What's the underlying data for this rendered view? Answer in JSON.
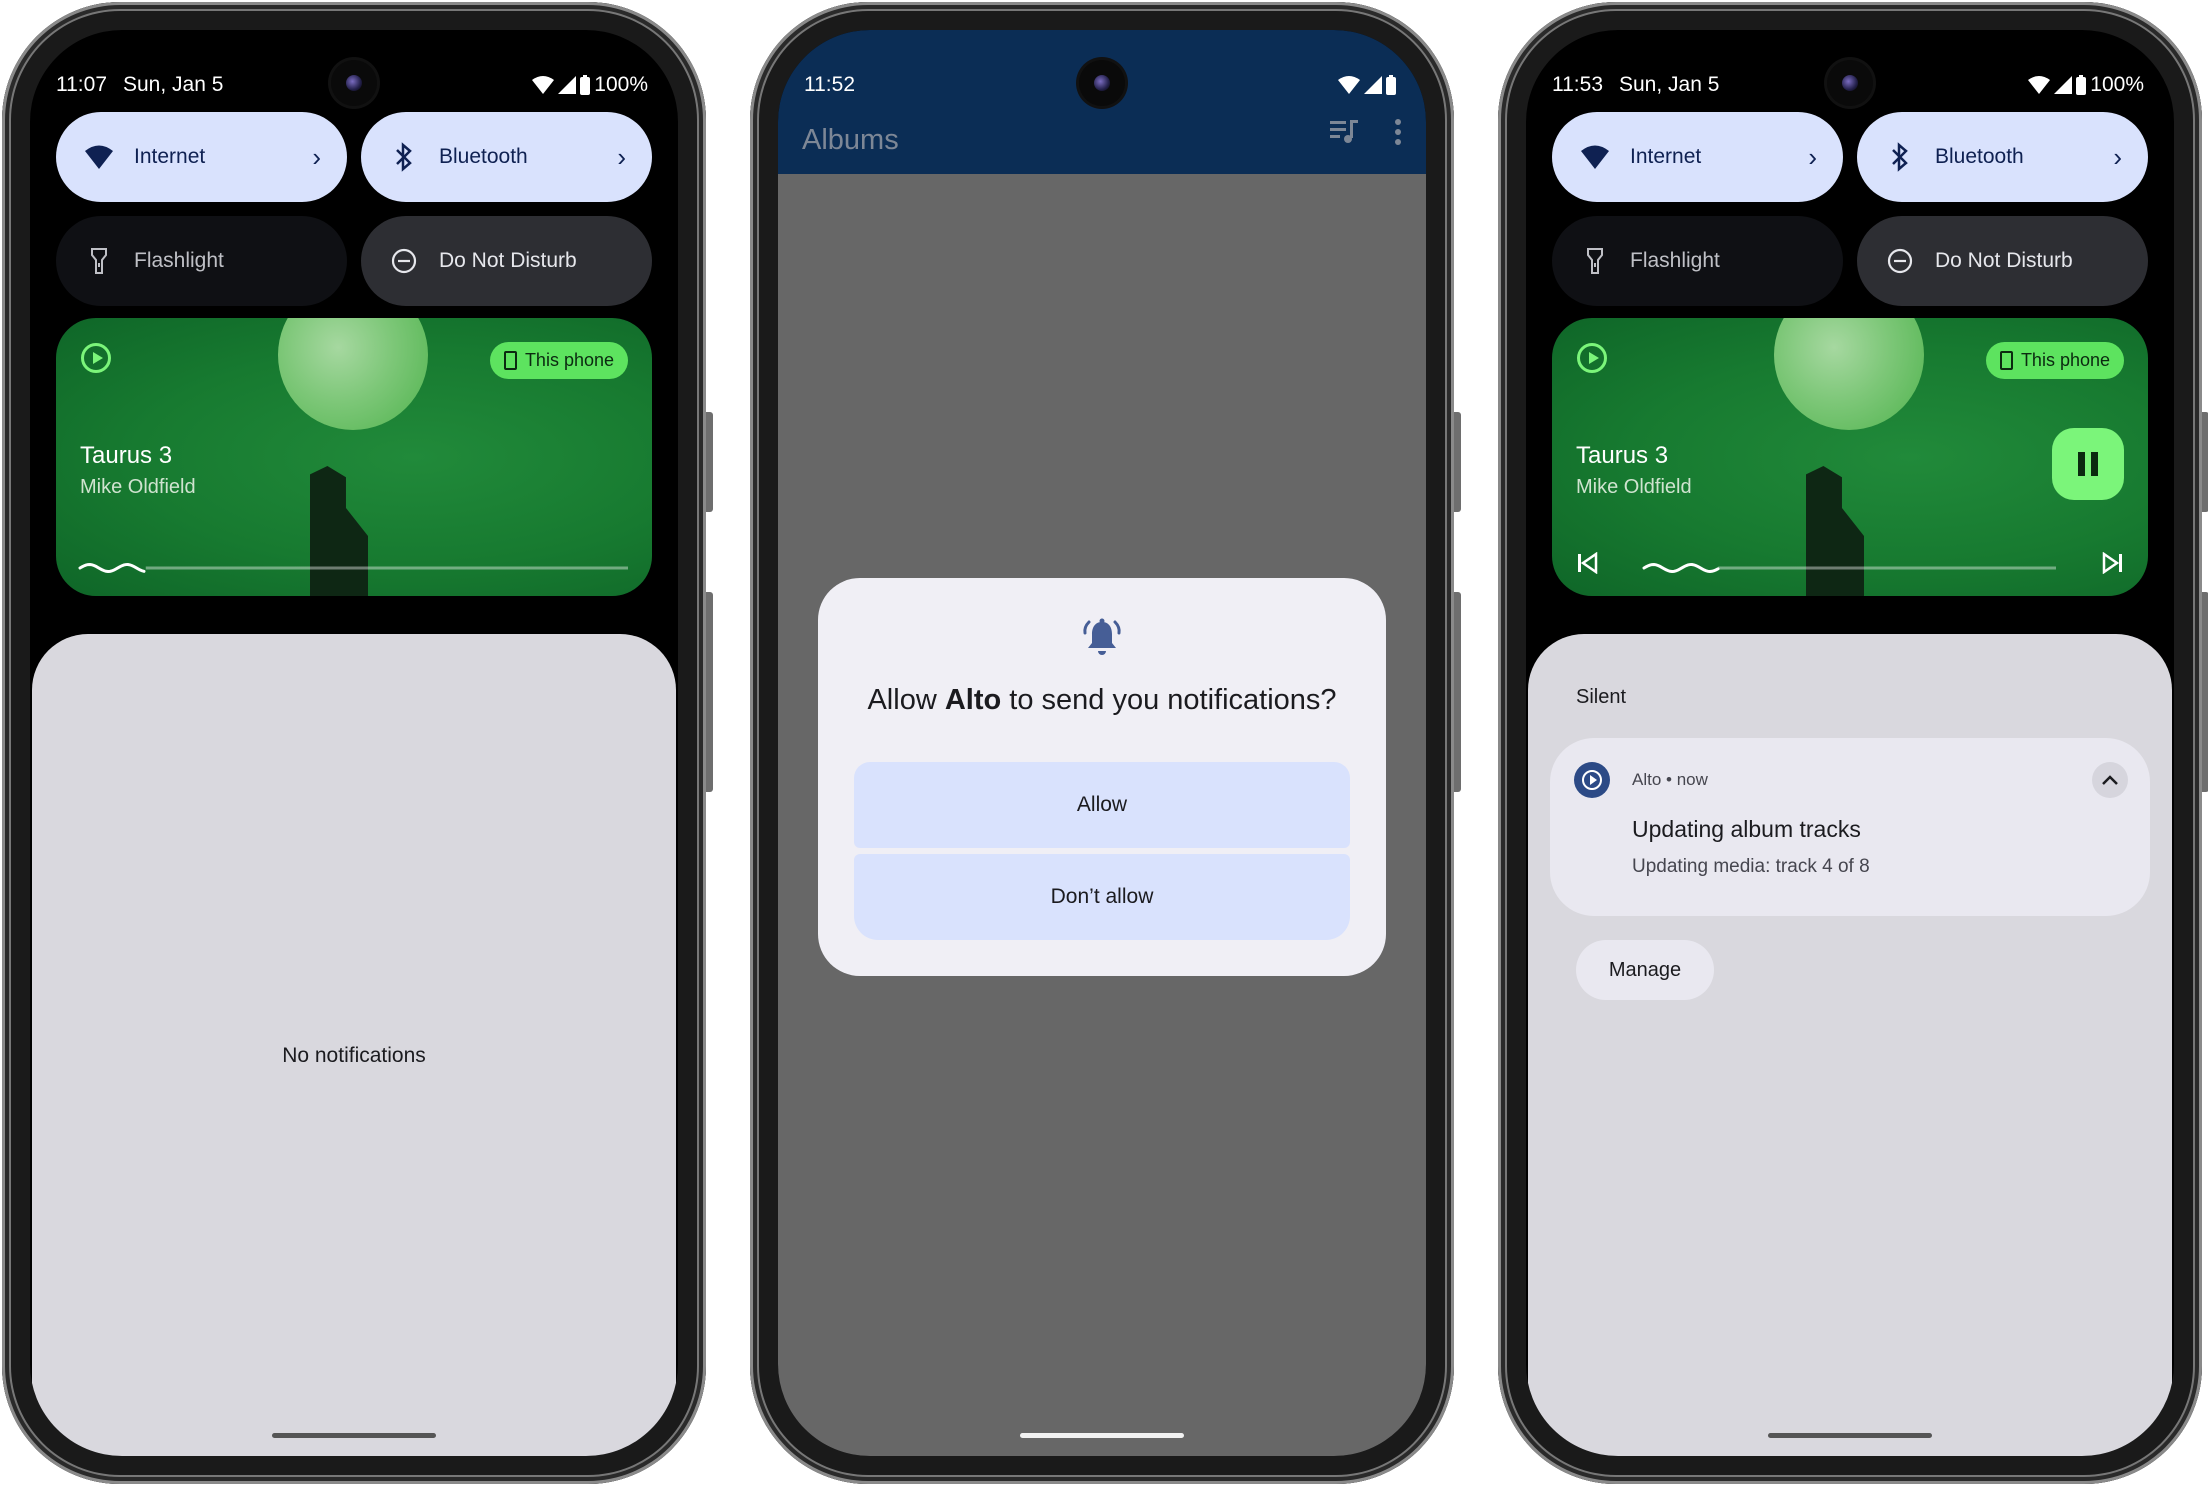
{
  "phones": [
    {
      "status": {
        "time": "11:07",
        "date": "Sun, Jan 5",
        "battery": "100%"
      },
      "tiles": [
        {
          "label": "Internet",
          "icon": "wifi-icon",
          "state": "on",
          "has_chevron": true
        },
        {
          "label": "Bluetooth",
          "icon": "bluetooth-icon",
          "state": "on",
          "has_chevron": true
        },
        {
          "label": "Flashlight",
          "icon": "flashlight-icon",
          "state": "off"
        },
        {
          "label": "Do Not Disturb",
          "icon": "do-not-disturb-icon",
          "state": "off"
        }
      ],
      "media": {
        "title": "Taurus 3",
        "artist": "Mike Oldfield",
        "output_chip": "This phone",
        "progress": 0.12
      },
      "shade": {
        "empty_text": "No notifications"
      }
    },
    {
      "status": {
        "time": "11:52"
      },
      "app": {
        "title": "Albums",
        "icons": [
          "queue-music-icon",
          "more-vert-icon"
        ]
      },
      "dialog": {
        "icon": "notification-bell-icon",
        "question_prefix": "Allow ",
        "app_name": "Alto",
        "question_suffix": " to send you notifications?",
        "allow_label": "Allow",
        "deny_label": "Don’t allow"
      }
    },
    {
      "status": {
        "time": "11:53",
        "date": "Sun, Jan 5",
        "battery": "100%"
      },
      "tiles": [
        {
          "label": "Internet",
          "icon": "wifi-icon",
          "state": "on",
          "has_chevron": true
        },
        {
          "label": "Bluetooth",
          "icon": "bluetooth-icon",
          "state": "on",
          "has_chevron": true
        },
        {
          "label": "Flashlight",
          "icon": "flashlight-icon",
          "state": "off"
        },
        {
          "label": "Do Not Disturb",
          "icon": "do-not-disturb-icon",
          "state": "off"
        }
      ],
      "media": {
        "title": "Taurus 3",
        "artist": "Mike Oldfield",
        "output_chip": "This phone",
        "progress": 0.18,
        "playing": true
      },
      "notifications": {
        "section": "Silent",
        "items": [
          {
            "app": "Alto",
            "time": "now",
            "title": "Updating album tracks",
            "text": "Updating media: track 4 of 8"
          }
        ],
        "manage_label": "Manage"
      }
    }
  ],
  "colors": {
    "tile_on": "#d9e2fd",
    "tile_off": "#0f1014",
    "media_accent": "#7bf57a",
    "app_bar": "#0b2d55",
    "scrim": "#676767",
    "shade": "#d9d8de",
    "bell": "#465e96"
  }
}
